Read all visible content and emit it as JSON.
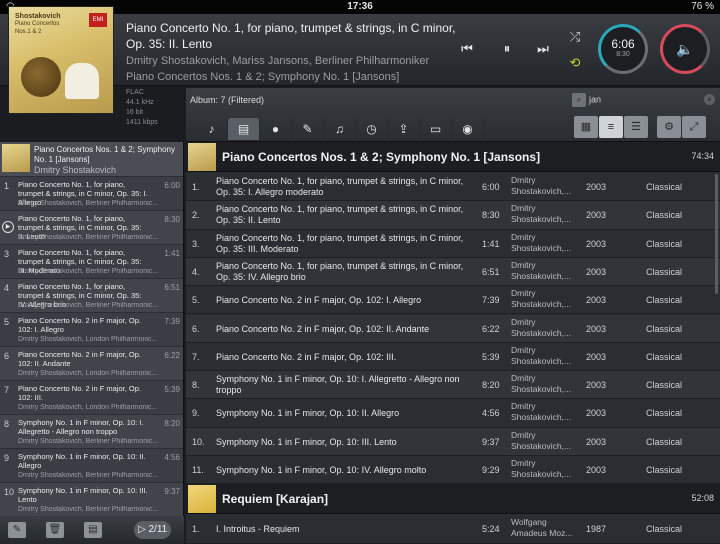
{
  "status": {
    "time": "17:36",
    "battery": "76 %",
    "wifi_icon": "wifi-icon"
  },
  "now_playing": {
    "title": "Piano Concerto No. 1, for piano, trumpet & strings, in C minor, Op. 35: II. Lento",
    "artists": "Dmitry Shostakovich, Mariss Jansons, Berliner Philharmoniker",
    "album": "Piano Concertos Nos. 1 & 2; Symphony No. 1 [Jansons]",
    "time": "6:06",
    "time_total": "8:30",
    "cover_title": "Shostakovich",
    "cover_sub": "Piano Concertos Nos.1 & 2",
    "format": [
      "FLAC",
      "44.1 kHz",
      "16 bit",
      "1411 kbps"
    ]
  },
  "toolbar": {
    "filter_label": "Album: 7 (Filtered)",
    "search_value": "jan",
    "tabs": [
      "♪",
      "▤",
      "●",
      "✎",
      "♫",
      "◷",
      "⇪",
      "▭",
      "◉"
    ],
    "views": [
      "▦",
      "≡",
      "☰"
    ]
  },
  "queue": {
    "header_title": "Piano Concertos Nos. 1 & 2; Symphony No. 1 [Jansons]",
    "header_sub": "Dmitry Shostakovich",
    "counter": "2/11",
    "items": [
      {
        "n": "1",
        "title": "Piano Concerto No. 1, for piano, trumpet & strings, in C minor, Op. 35: I. Allegro",
        "dur": "6:00",
        "artist": "Dmitry Shostakovich, Berliner Philharmonic..."
      },
      {
        "n": "",
        "title": "Piano Concerto No. 1, for piano, trumpet & strings, in C minor, Op. 35: II. Lento",
        "dur": "8:30",
        "artist": "Dmitry Shostakovich, Berliner Philharmonic..."
      },
      {
        "n": "3",
        "title": "Piano Concerto No. 1, for piano, trumpet & strings, in C minor, Op. 35: III. Moderato",
        "dur": "1:41",
        "artist": "Dmitry Shostakovich, Berliner Philharmonic..."
      },
      {
        "n": "4",
        "title": "Piano Concerto No. 1, for piano, trumpet & strings, in C minor, Op. 35: IV. Allegro brio",
        "dur": "6:51",
        "artist": "Dmitry Shostakovich, Berliner Philharmonic..."
      },
      {
        "n": "5",
        "title": "Piano Concerto No. 2 in F major, Op. 102: I. Allegro",
        "dur": "7:39",
        "artist": "Dmitry Shostakovich, London Philharmonic..."
      },
      {
        "n": "6",
        "title": "Piano Concerto No. 2 in F major, Op. 102: II. Andante",
        "dur": "6:22",
        "artist": "Dmitry Shostakovich, London Philharmonic..."
      },
      {
        "n": "7",
        "title": "Piano Concerto No. 2 in F major, Op. 102: III.",
        "dur": "5:39",
        "artist": "Dmitry Shostakovich, London Philharmonic..."
      },
      {
        "n": "8",
        "title": "Symphony No. 1 in F minor, Op. 10: I. Allegretto - Allegro non troppo",
        "dur": "8:20",
        "artist": "Dmitry Shostakovich, Berliner Philharmonic..."
      },
      {
        "n": "9",
        "title": "Symphony No. 1 in F minor, Op. 10: II. Allegro",
        "dur": "4:56",
        "artist": "Dmitry Shostakovich, Berliner Philharmonic..."
      },
      {
        "n": "10",
        "title": "Symphony No. 1 in F minor, Op. 10: III. Lento",
        "dur": "9:37",
        "artist": "Dmitry Shostakovich, Berliner Philharmonic..."
      }
    ]
  },
  "albums": [
    {
      "title": "Piano Concertos Nos. 1 & 2; Symphony No. 1 [Jansons]",
      "duration": "74:34",
      "tracks": [
        {
          "n": "1.",
          "title": "Piano Concerto No. 1, for piano, trumpet & strings, in C minor, Op. 35: I. Allegro moderato",
          "dur": "6:00",
          "artist": "Dmitry Shostakovich,...",
          "year": "2003",
          "genre": "Classical"
        },
        {
          "n": "2.",
          "title": "Piano Concerto No. 1, for piano, trumpet & strings, in C minor, Op. 35: II. Lento",
          "dur": "8:30",
          "artist": "Dmitry Shostakovich,...",
          "year": "2003",
          "genre": "Classical"
        },
        {
          "n": "3.",
          "title": "Piano Concerto No. 1, for piano, trumpet & strings, in C minor, Op. 35: III. Moderato",
          "dur": "1:41",
          "artist": "Dmitry Shostakovich,...",
          "year": "2003",
          "genre": "Classical"
        },
        {
          "n": "4.",
          "title": "Piano Concerto No. 1, for piano, trumpet & strings, in C minor, Op. 35: IV. Allegro brio",
          "dur": "6:51",
          "artist": "Dmitry Shostakovich,...",
          "year": "2003",
          "genre": "Classical"
        },
        {
          "n": "5.",
          "title": "Piano Concerto No. 2 in F major, Op. 102: I. Allegro",
          "dur": "7:39",
          "artist": "Dmitry Shostakovich,...",
          "year": "2003",
          "genre": "Classical"
        },
        {
          "n": "6.",
          "title": "Piano Concerto No. 2 in F major, Op. 102: II. Andante",
          "dur": "6:22",
          "artist": "Dmitry Shostakovich,...",
          "year": "2003",
          "genre": "Classical"
        },
        {
          "n": "7.",
          "title": "Piano Concerto No. 2 in F major, Op. 102: III.",
          "dur": "5:39",
          "artist": "Dmitry Shostakovich,...",
          "year": "2003",
          "genre": "Classical"
        },
        {
          "n": "8.",
          "title": "Symphony No. 1 in F minor, Op. 10: I. Allegretto - Allegro non troppo",
          "dur": "8:20",
          "artist": "Dmitry Shostakovich,...",
          "year": "2003",
          "genre": "Classical"
        },
        {
          "n": "9.",
          "title": "Symphony No. 1 in F minor, Op. 10: II. Allegro",
          "dur": "4:56",
          "artist": "Dmitry Shostakovich,...",
          "year": "2003",
          "genre": "Classical"
        },
        {
          "n": "10.",
          "title": "Symphony No. 1 in F minor, Op. 10: III. Lento",
          "dur": "9:37",
          "artist": "Dmitry Shostakovich,...",
          "year": "2003",
          "genre": "Classical"
        },
        {
          "n": "11.",
          "title": "Symphony No. 1 in F minor, Op. 10: IV. Allegro molto",
          "dur": "9:29",
          "artist": "Dmitry Shostakovich,...",
          "year": "2003",
          "genre": "Classical"
        }
      ]
    },
    {
      "title": "Requiem [Karajan]",
      "duration": "52:08",
      "tracks": [
        {
          "n": "1.",
          "title": "I. Introitus - Requiem",
          "dur": "5:24",
          "artist": "Wolfgang Amadeus Moz...",
          "year": "1987",
          "genre": "Classical"
        }
      ]
    }
  ],
  "colors": {
    "accent_time": "#2aa7b8",
    "accent_volume": "#d84a5b",
    "repeat": "#c7d22a"
  }
}
